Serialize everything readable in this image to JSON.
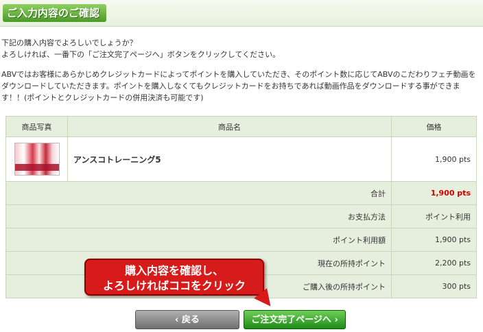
{
  "header": {
    "title": "ご入力内容のご確認"
  },
  "intro": {
    "line1": "下記の購入内容でよろしいでしょうか？",
    "line2": "よろしければ、一番下の「ご注文完了ページへ」ボタンをクリックしてください。"
  },
  "description": "ABVではお客様にあらかじめクレジットカードによってポイントを購入していただき、そのポイント数に応じてABVのこだわりフェチ動画をダウンロードしていただきます。ポイントを購入しなくてもクレジットカードをお持ちであれば動画作品をダウンロードする事ができます！！(ポイントとクレジットカードの併用決済も可能です)",
  "table": {
    "headers": {
      "photo": "商品写真",
      "name": "商品名",
      "price": "価格"
    },
    "item": {
      "name": "アンスコトレーニング5",
      "price": "1,900 pts"
    },
    "summary": [
      {
        "label": "合計",
        "value": "1,900 pts"
      },
      {
        "label": "お支払方法",
        "value": "ポイント利用"
      },
      {
        "label": "ポイント利用額",
        "value": "1,900 pts"
      },
      {
        "label": "現在の所持ポイント",
        "value": "2,200 pts"
      },
      {
        "label": "ご購入後の所持ポイント",
        "value": "300 pts"
      }
    ]
  },
  "callout": {
    "line1": "購入内容を確認し、",
    "line2": "よろしければココをクリック"
  },
  "buttons": {
    "back": "‹ 戻る",
    "complete": "ご注文完了ページへ ›"
  },
  "colors": {
    "accent_green": "#4c9a27",
    "total_red": "#cc0000",
    "callout_red": "#d71a1a"
  }
}
